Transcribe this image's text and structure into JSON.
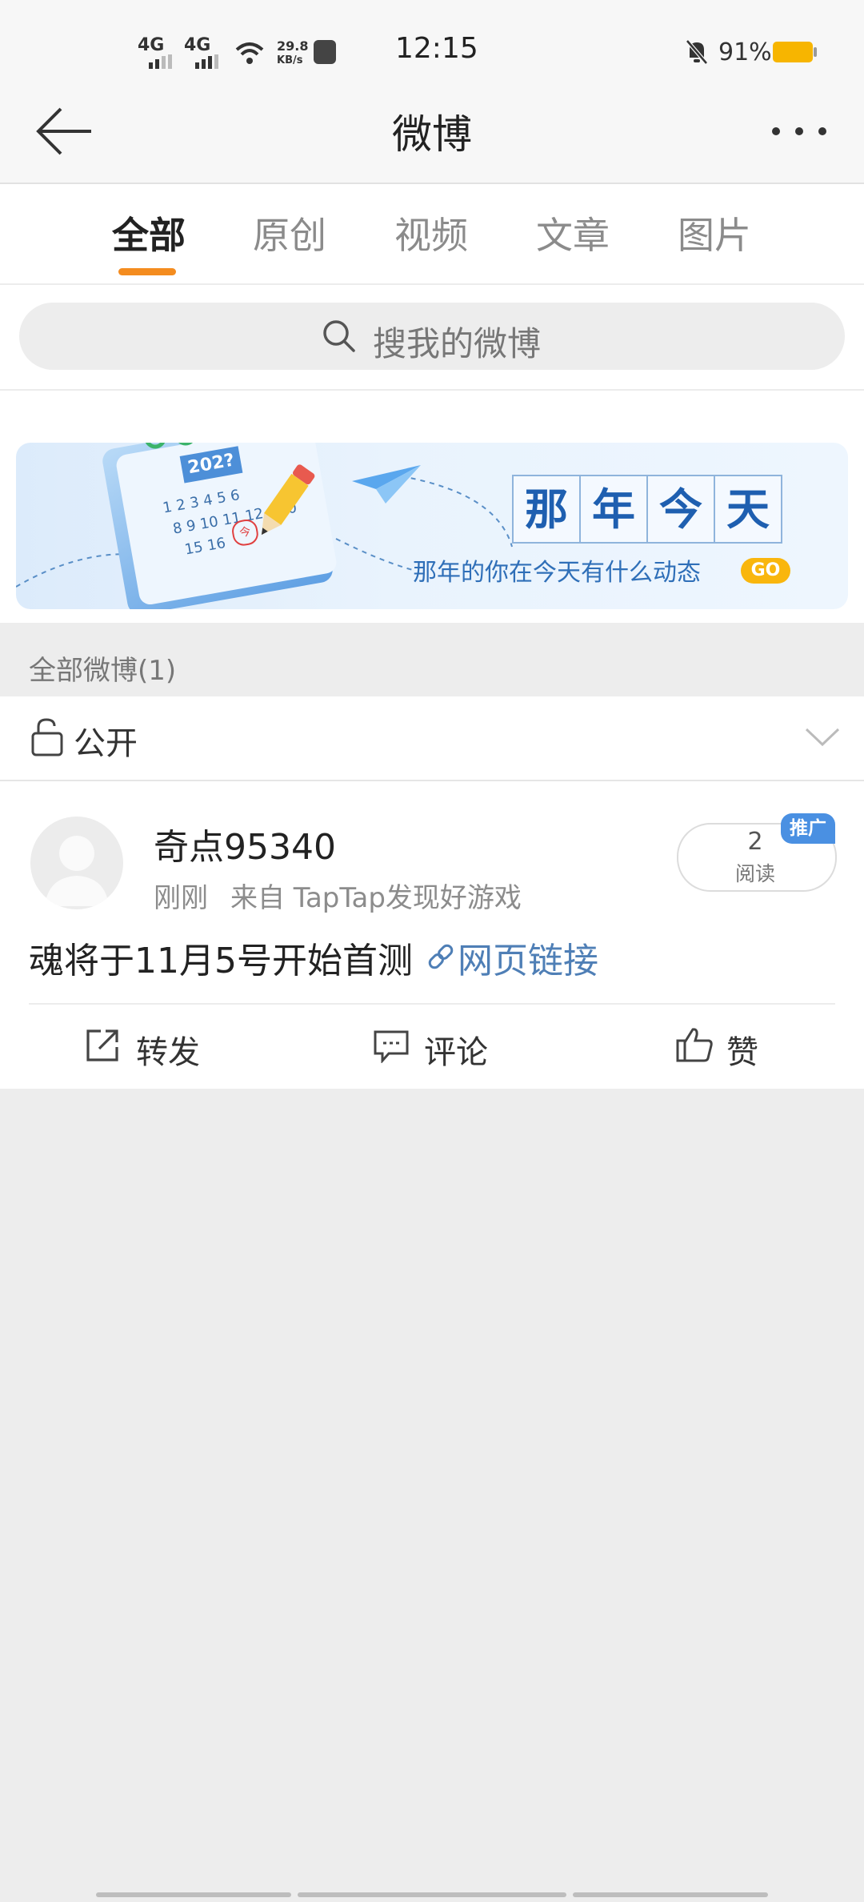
{
  "status_bar": {
    "network1": "4G",
    "network2": "4G",
    "speed_value": "29.8",
    "speed_unit": "KB/s",
    "time": "12:15",
    "battery": "91%"
  },
  "header": {
    "title": "微博"
  },
  "tabs": [
    {
      "label": "全部",
      "active": true
    },
    {
      "label": "原创",
      "active": false
    },
    {
      "label": "视频",
      "active": false
    },
    {
      "label": "文章",
      "active": false
    },
    {
      "label": "图片",
      "active": false
    }
  ],
  "search": {
    "placeholder": "搜我的微博"
  },
  "banner": {
    "calendar_year": "202?",
    "calendar_row1": "1 2 3 4 5 6",
    "calendar_row2": "8 9 10 11 12",
    "calendar_row3": "15 16",
    "calendar_num": "20",
    "calendar_mark": "今",
    "title_chars": [
      "那",
      "年",
      "今",
      "天"
    ],
    "subtitle": "那年的你在今天有什么动态",
    "go_label": "GO"
  },
  "section": {
    "label": "全部微博(1)"
  },
  "visibility": {
    "label": "公开"
  },
  "post": {
    "username": "奇点95340",
    "time": "刚刚",
    "source": "来自 TapTap发现好游戏",
    "read_count": "2",
    "read_label": "阅读",
    "promo_badge": "推广",
    "text": "魂将于11月5号开始首测",
    "link_text": "网页链接",
    "actions": {
      "repost": "转发",
      "comment": "评论",
      "like": "赞"
    }
  },
  "colors": {
    "accent_orange": "#f48c1f",
    "link_blue": "#4f7fb6",
    "promo_blue": "#4a90e2",
    "go_yellow": "#f9b60d",
    "battery_yellow": "#f7b500"
  }
}
